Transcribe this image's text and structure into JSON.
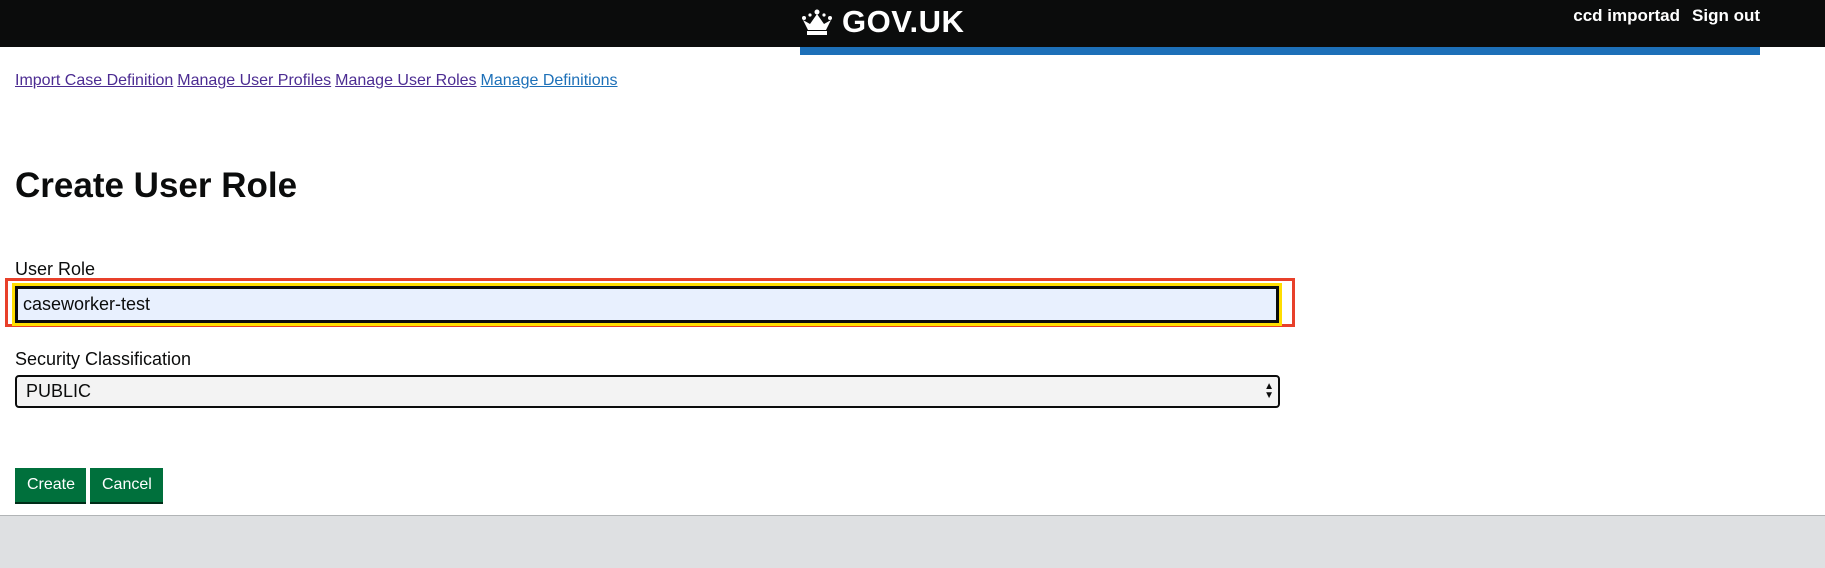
{
  "header": {
    "logo_text": "GOV.UK",
    "user_name": "ccd importad",
    "sign_out_label": "Sign out"
  },
  "nav": {
    "links": [
      "Import Case Definition",
      "Manage User Profiles",
      "Manage User Roles",
      "Manage Definitions"
    ]
  },
  "page": {
    "title": "Create User Role"
  },
  "form": {
    "user_role_label": "User Role",
    "user_role_value": "caseworker-test",
    "security_label": "Security Classification",
    "security_value": "PUBLIC"
  },
  "buttons": {
    "create_label": "Create",
    "cancel_label": "Cancel"
  },
  "colors": {
    "header_bg": "#0b0c0c",
    "header_accent": "#1d70b8",
    "button_green": "#00703c",
    "highlight_red": "#e8402a",
    "focus_yellow": "#ffdd00"
  },
  "icons": {
    "logo": "crown-icon",
    "select": "select-arrows-icon"
  }
}
